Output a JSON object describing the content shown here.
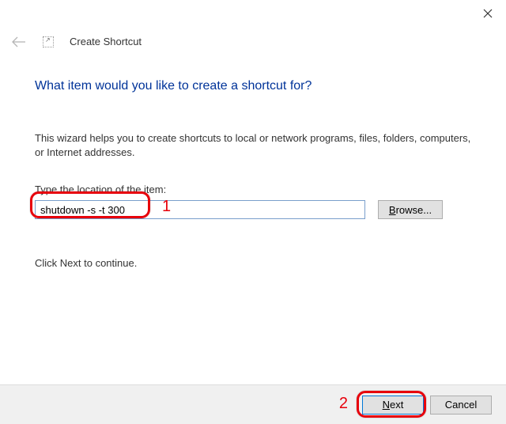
{
  "window": {
    "title": "Create Shortcut"
  },
  "heading": "What item would you like to create a shortcut for?",
  "description": "This wizard helps you to create shortcuts to local or network programs, files, folders, computers, or Internet addresses.",
  "location": {
    "label": "Type the location of the item:",
    "value": "shutdown -s -t 300",
    "browse_label": "rowse..."
  },
  "continue_text": "Click Next to continue.",
  "footer": {
    "next_label": "ext",
    "cancel_label": "Cancel"
  },
  "annotations": {
    "num1": "1",
    "num2": "2"
  }
}
